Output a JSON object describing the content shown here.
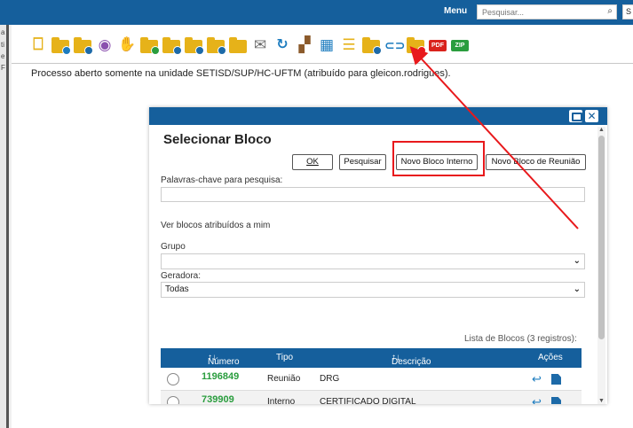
{
  "topbar": {
    "menu_label": "Menu",
    "search_placeholder": "Pesquisar...",
    "right_button_label": "S",
    "background": "#155f9c"
  },
  "sidebar": {
    "labels": [
      "a",
      "ti",
      "e",
      "F"
    ]
  },
  "toolbar": {
    "icons": [
      {
        "name": "new-document-icon"
      },
      {
        "name": "folder-sync-icon"
      },
      {
        "name": "folder-settings-icon"
      },
      {
        "name": "eye-icon"
      },
      {
        "name": "thumbs-up-icon"
      },
      {
        "name": "folder-send-icon"
      },
      {
        "name": "folder-info-icon"
      },
      {
        "name": "folder-user-icon"
      },
      {
        "name": "folder-star-icon"
      },
      {
        "name": "folder-icon"
      },
      {
        "name": "envelope-icon"
      },
      {
        "name": "refresh-icon"
      },
      {
        "name": "block-add-icon"
      },
      {
        "name": "grid-add-icon"
      },
      {
        "name": "note-icon"
      },
      {
        "name": "folder-pause-icon"
      },
      {
        "name": "link-icon"
      },
      {
        "name": "folder-delete-icon"
      },
      {
        "name": "pdf-icon",
        "text": "PDF"
      },
      {
        "name": "zip-icon",
        "text": "ZIP"
      }
    ]
  },
  "process_info": "Processo aberto somente na unidade SETISD/SUP/HC-UFTM (atribuído para gleicon.rodrigues).",
  "modal": {
    "title": "Selecionar Bloco",
    "buttons": {
      "ok": "OK",
      "pesquisar": "Pesquisar",
      "novo_interno": "Novo Bloco Interno",
      "novo_reuniao": "Novo Bloco de Reunião"
    },
    "keywords_label": "Palavras-chave para pesquisa:",
    "keywords_value": "",
    "assigned_label": "Ver blocos atribuídos a mim",
    "grupo_label": "Grupo",
    "grupo_value": "",
    "geradora_label": "Geradora:",
    "geradora_value": "Todas",
    "list_caption": "Lista de Blocos (3 registros):",
    "table": {
      "headers": {
        "numero": "Número",
        "tipo": "Tipo",
        "descricao": "Descrição",
        "acoes": "Ações"
      },
      "rows": [
        {
          "numero": "1196849",
          "tipo": "Reunião",
          "descricao": "DRG"
        },
        {
          "numero": "739909",
          "tipo": "Interno",
          "descricao": "CERTIFICADO DIGITAL"
        }
      ]
    }
  },
  "colors": {
    "primary": "#155f9c",
    "annotation": "#e8191c",
    "number": "#2a9d3e",
    "folder": "#e6b219"
  }
}
